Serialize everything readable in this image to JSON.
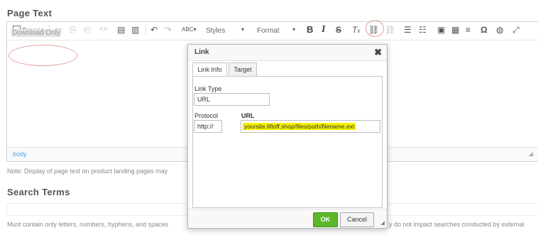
{
  "page_text": {
    "title": "Page Text"
  },
  "toolbar": {
    "source": "Source",
    "styles": "Styles",
    "format": "Format",
    "bold": "B",
    "italic": "I",
    "omega": "Ω",
    "spell": "ABC"
  },
  "editor": {
    "content": "Download Only",
    "path": "body"
  },
  "note1": "Note: Display of page text on product landing pages may",
  "search_terms": {
    "title": "Search Terms"
  },
  "note2": "Must contain only letters, numbers, hyphens, and spaces",
  "note2_right": "y do not impact searches conducted by external",
  "dialog": {
    "title": "Link",
    "close": "✖",
    "tabs": [
      "Link Info",
      "Target"
    ],
    "link_type_label": "Link Type",
    "link_type_value": "URL",
    "protocol_label": "Protocol",
    "protocol_value": "http://",
    "url_label": "URL",
    "url_value": "yoursite.liftoff.shop/files/path/filename.ext",
    "ok": "OK",
    "cancel": "Cancel"
  },
  "colors": {
    "ok_green": "#5cb52a",
    "highlight_yellow": "#f6f200",
    "annotation_red": "#e8a0a0",
    "path_blue": "#4aa3df"
  }
}
